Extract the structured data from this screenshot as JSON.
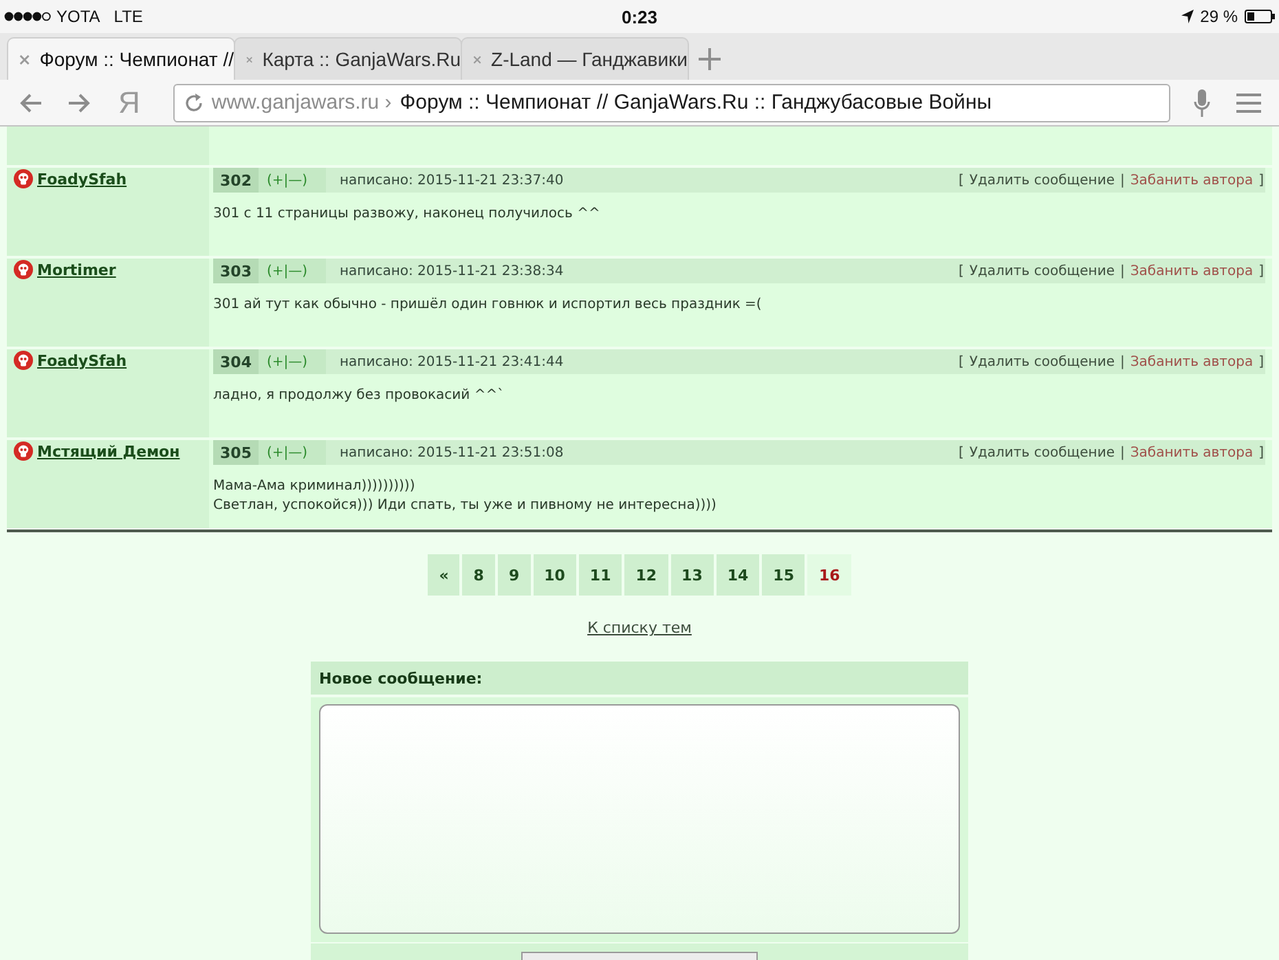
{
  "status_bar": {
    "carrier": "YOTA",
    "network": "LTE",
    "time": "0:23",
    "battery": "29 %"
  },
  "tabs": [
    {
      "title": "Форум :: Чемпионат //",
      "selected": true
    },
    {
      "title": "Карта :: GanjaWars.Ru",
      "selected": false
    },
    {
      "title": "Z-Land — Ганджавики",
      "selected": false
    }
  ],
  "toolbar": {
    "logo": "Я",
    "url": {
      "domain": "www.ganjawars.ru ›",
      "title": "Форум :: Чемпионат // GanjaWars.Ru :: Ганджубасовые Войны"
    }
  },
  "posts": [
    {
      "author": "FoadySfah",
      "number": "302",
      "vote": "(+|—)",
      "date": "написано: 2015-11-21 23:37:40",
      "actions": {
        "open": "[",
        "delete": "Удалить сообщение",
        "separator": "|",
        "ban": "Забанить автора",
        "close": "]"
      },
      "lines": [
        "301 с 11 страницы развожу, наконец получилось ^^"
      ]
    },
    {
      "author": "Mortimer",
      "number": "303",
      "vote": "(+|—)",
      "date": "написано: 2015-11-21 23:38:34",
      "actions": {
        "open": "[",
        "delete": "Удалить сообщение",
        "separator": "|",
        "ban": "Забанить автора",
        "close": "]"
      },
      "lines": [
        "301 ай тут как обычно - пришёл один говнюк и испортил весь праздник =("
      ]
    },
    {
      "author": "FoadySfah",
      "number": "304",
      "vote": "(+|—)",
      "date": "написано: 2015-11-21 23:41:44",
      "actions": {
        "open": "[",
        "delete": "Удалить сообщение",
        "separator": "|",
        "ban": "Забанить автора",
        "close": "]"
      },
      "lines": [
        "ладно, я продолжу без провокасий ^^`"
      ]
    },
    {
      "author": "Мстящий Демон",
      "number": "305",
      "vote": "(+|—)",
      "date": "написано: 2015-11-21 23:51:08",
      "actions": {
        "open": "[",
        "delete": "Удалить сообщение",
        "separator": "|",
        "ban": "Забанить автора",
        "close": "]"
      },
      "lines": [
        "Мама-Ама криминал))))))))))",
        "Светлан, успокойся))) Иди спать, ты уже и пивному не интересна))))"
      ]
    }
  ],
  "pagination": [
    {
      "label": "«",
      "selected": false
    },
    {
      "label": "8",
      "selected": false
    },
    {
      "label": "9",
      "selected": false
    },
    {
      "label": "10",
      "selected": false
    },
    {
      "label": "11",
      "selected": false
    },
    {
      "label": "12",
      "selected": false
    },
    {
      "label": "13",
      "selected": false
    },
    {
      "label": "14",
      "selected": false
    },
    {
      "label": "15",
      "selected": false
    },
    {
      "label": "16",
      "selected": true
    }
  ],
  "back_link": "К списку тем",
  "new_message": {
    "title": "Новое сообщение:"
  }
}
